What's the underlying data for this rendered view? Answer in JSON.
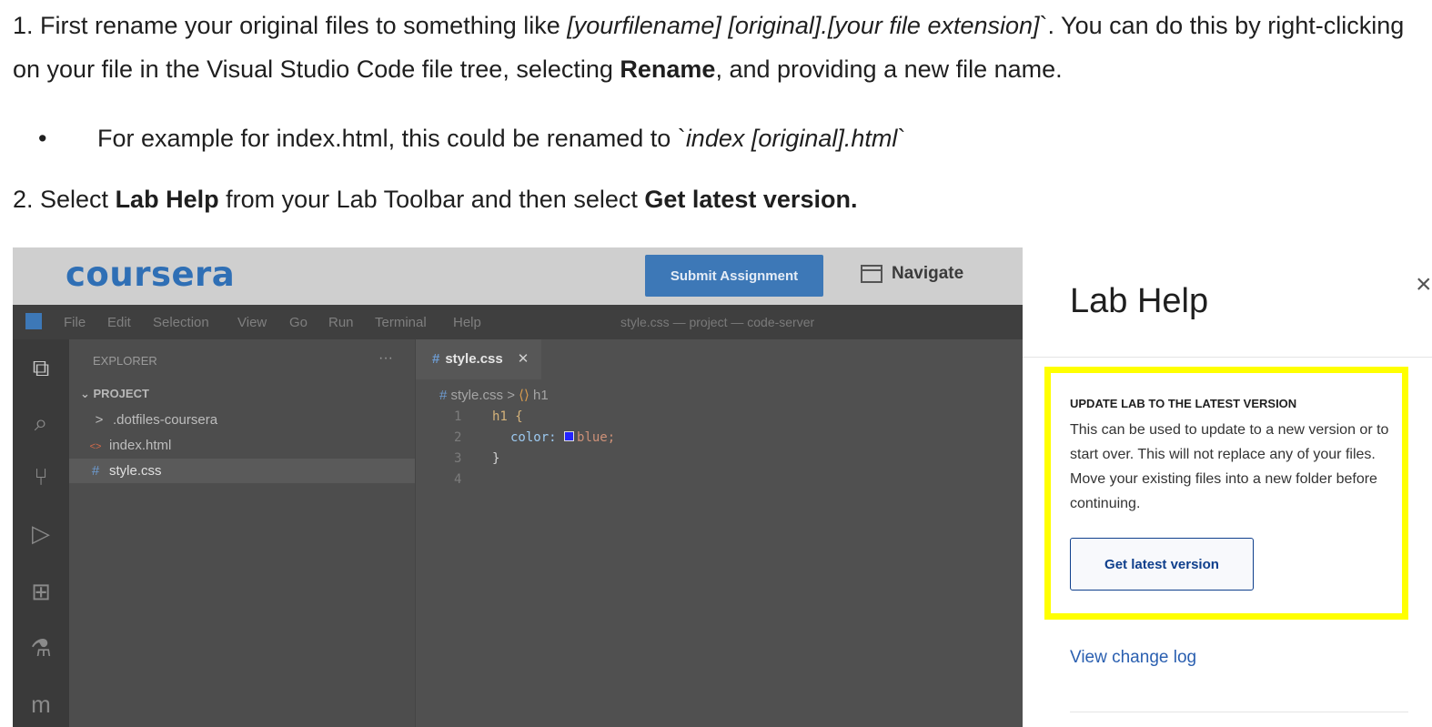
{
  "doc": {
    "p1_a": "1. First rename your original files to something like ",
    "p1_b": "[yourfilename] [original].[your file extension]",
    "p1_c": "`. You can do this by right-clicking on your file in the Visual Studio Code file tree, selecting ",
    "p1_d": "Rename",
    "p1_e": ", and providing a new file name.",
    "bullet_dot": "•",
    "bullet_a": "For example for index.html, this could be renamed to  `",
    "bullet_b": "index [original].html",
    "bullet_c": "`",
    "p2_a": "2. Select ",
    "p2_b": "Lab Help",
    "p2_c": " from your Lab Toolbar and then select ",
    "p2_d": "Get latest version."
  },
  "coursera": {
    "logo": "coursera",
    "submit": "Submit Assignment",
    "navigate": "Navigate"
  },
  "vscode": {
    "menu": [
      "File",
      "Edit",
      "Selection",
      "View",
      "Go",
      "Run",
      "Terminal",
      "Help"
    ],
    "window_title": "style.css — project — code-server",
    "explorer_title": "EXPLORER",
    "explorer_more": "···",
    "project": "PROJECT",
    "tree": [
      {
        "icon": ">",
        "label": ".dotfiles-coursera"
      },
      {
        "icon": "<>",
        "label": "index.html"
      },
      {
        "icon": "#",
        "label": "style.css"
      }
    ],
    "tab_label": "style.css",
    "tab_close": "✕",
    "crumb_file": "style.css",
    "crumb_sep": ">",
    "crumb_sym": "h1",
    "lines": [
      "1",
      "2",
      "3",
      "4"
    ],
    "code": {
      "l1": "h1 {",
      "l2_prop": "color:",
      "l2_val": "blue;",
      "l3": "}"
    }
  },
  "panel": {
    "title": "Lab Help",
    "close": "×",
    "heading": "UPDATE LAB TO THE LATEST VERSION",
    "body": "This can be used to update to a new version or to start over. This will not replace any of your files. Move your existing files into a new folder before continuing.",
    "button": "Get latest version",
    "link": "View change log"
  },
  "colors": {
    "accent": "#3d78b7",
    "highlight": "#ffff00",
    "link": "#2a5fb0"
  }
}
